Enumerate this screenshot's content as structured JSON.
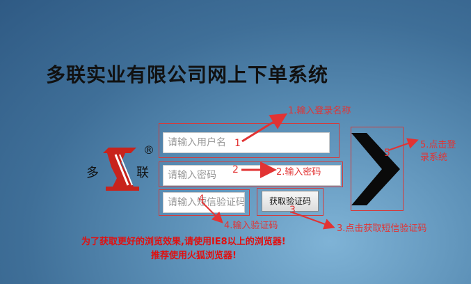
{
  "title": "多联实业有限公司网上下单系统",
  "logo": {
    "char_left": "多",
    "char_right": "联",
    "registered": "®"
  },
  "form": {
    "username_placeholder": "请输入用户名",
    "password_placeholder": "请输入密码",
    "sms_placeholder": "请输入短信验证码",
    "get_code_button": "获取验证码"
  },
  "annotations": {
    "step1": "1.输入登录名称",
    "step2": "2.输入密码",
    "step3": "3.点击获取短信验证码",
    "step4": "4.输入验证码",
    "step5_line1": "5.点击登",
    "step5_line2": "录系统",
    "n1": "1",
    "n2": "2",
    "n3": "3",
    "n4": "4",
    "n5": "5"
  },
  "notice": {
    "line1": "为了获取更好的浏览效果,请使用IE8以上的浏览器!",
    "line2": "推荐使用火狐浏览器!"
  },
  "colors": {
    "annotation": "#e23333",
    "title": "#111111"
  }
}
